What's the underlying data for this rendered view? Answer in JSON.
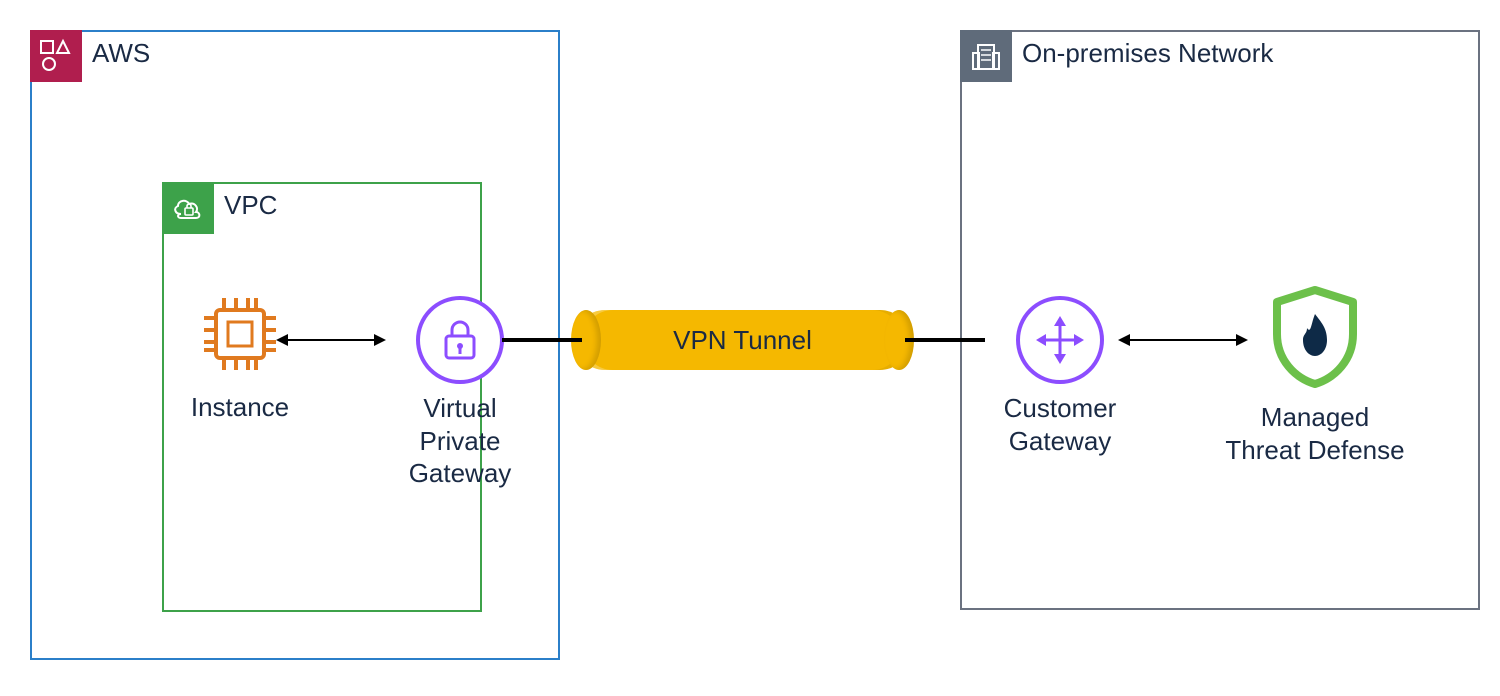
{
  "aws": {
    "label": "AWS",
    "vpc": {
      "label": "VPC",
      "instance": {
        "label": "Instance"
      },
      "vpg": {
        "label": "Virtual\nPrivate\nGateway"
      }
    }
  },
  "tunnel": {
    "label": "VPN Tunnel"
  },
  "onprem": {
    "label": "On-premises Network",
    "cgw": {
      "label": "Customer\nGateway"
    },
    "mtd": {
      "label": "Managed\nThreat Defense"
    }
  },
  "colors": {
    "aws_border": "#2b7fc9",
    "onprem_border": "#6b7280",
    "vpc_border": "#3da24a",
    "aws_badge": "#b01e4e",
    "vpc_badge": "#3da24a",
    "onprem_badge": "#5f6b7a",
    "purple": "#8c4dff",
    "instance": "#e07a1f",
    "tunnel": "#f5b800",
    "mtd_green": "#6cc04a",
    "mtd_flame": "#0e2a47"
  }
}
